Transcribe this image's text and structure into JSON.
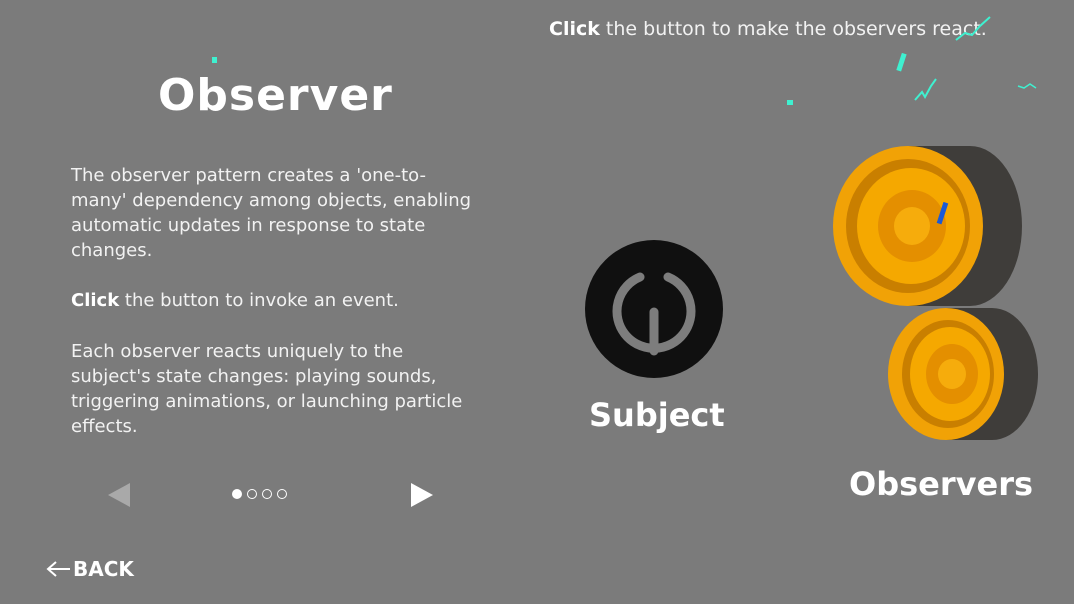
{
  "panel": {
    "title": "Observer",
    "description": "The observer pattern creates a 'one-to-many' dependency among objects, enabling automatic updates in response to state changes.",
    "click_bold": "Click",
    "click_rest": " the button to invoke an event.",
    "reaction": "Each observer reacts uniquely to the subject's state changes: playing sounds, triggering animations, or launching particle effects.",
    "pagination": {
      "current": 1,
      "total": 4
    }
  },
  "nav": {
    "back_label": "BACK"
  },
  "scene": {
    "instruction_bold": "Click",
    "instruction_rest": " the button to make the observers react.",
    "subject_label": "Subject",
    "observers_label": "Observers"
  },
  "colors": {
    "background": "#7b7b7b",
    "speaker_accent": "#f5a300",
    "confetti": "#3ff0d0"
  }
}
